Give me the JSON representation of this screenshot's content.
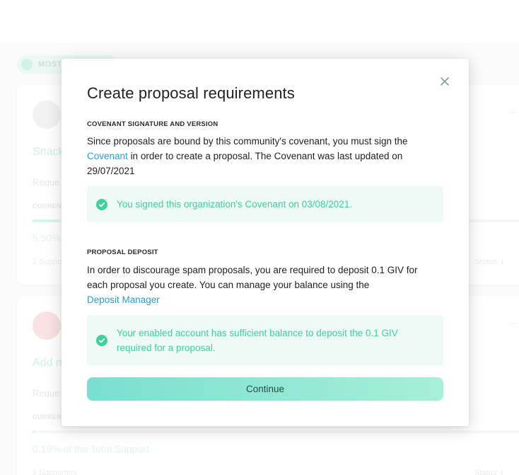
{
  "background": {
    "filter_pill": "MOST SUPPORTED",
    "cards": [
      {
        "title": "Snack",
        "requested": "Reque",
        "label": "CURRENT",
        "percent_text": "5.50%",
        "progress": 0.055,
        "supporters": "2 Support",
        "status": "Status: I"
      },
      {
        "title": "Add m",
        "requested": "Reque",
        "label": "CURRENT",
        "percent_text": "0.19% of the Total Support",
        "progress": 0.0019,
        "supporters": "2 Supporters",
        "status": "Status: ("
      }
    ]
  },
  "modal": {
    "title": "Create proposal requirements",
    "close_icon": "close-icon",
    "covenant": {
      "heading": "COVENANT SIGNATURE AND VERSION",
      "text_before": "Since proposals are bound by this community's covenant, you must sign the",
      "link": "Covenant",
      "text_after": "in order to create a proposal. The Covenant was last updated on 29/07/2021",
      "notice": "You signed this organization's Covenant on 03/08/2021."
    },
    "deposit": {
      "heading": "PROPOSAL DEPOSIT",
      "text": "In order to discourage spam proposals, you are required to deposit 0.1 GIV for each proposal you create. You can manage your balance using the",
      "link": "Deposit Manager",
      "notice": "Your enabled account has sufficient balance to deposit the 0.1 GIV required for a proposal."
    },
    "continue_label": "Continue"
  },
  "colors": {
    "accent": "#3ecfa0",
    "link": "#2f9bd8",
    "notice_bg": "#eefaf5"
  }
}
